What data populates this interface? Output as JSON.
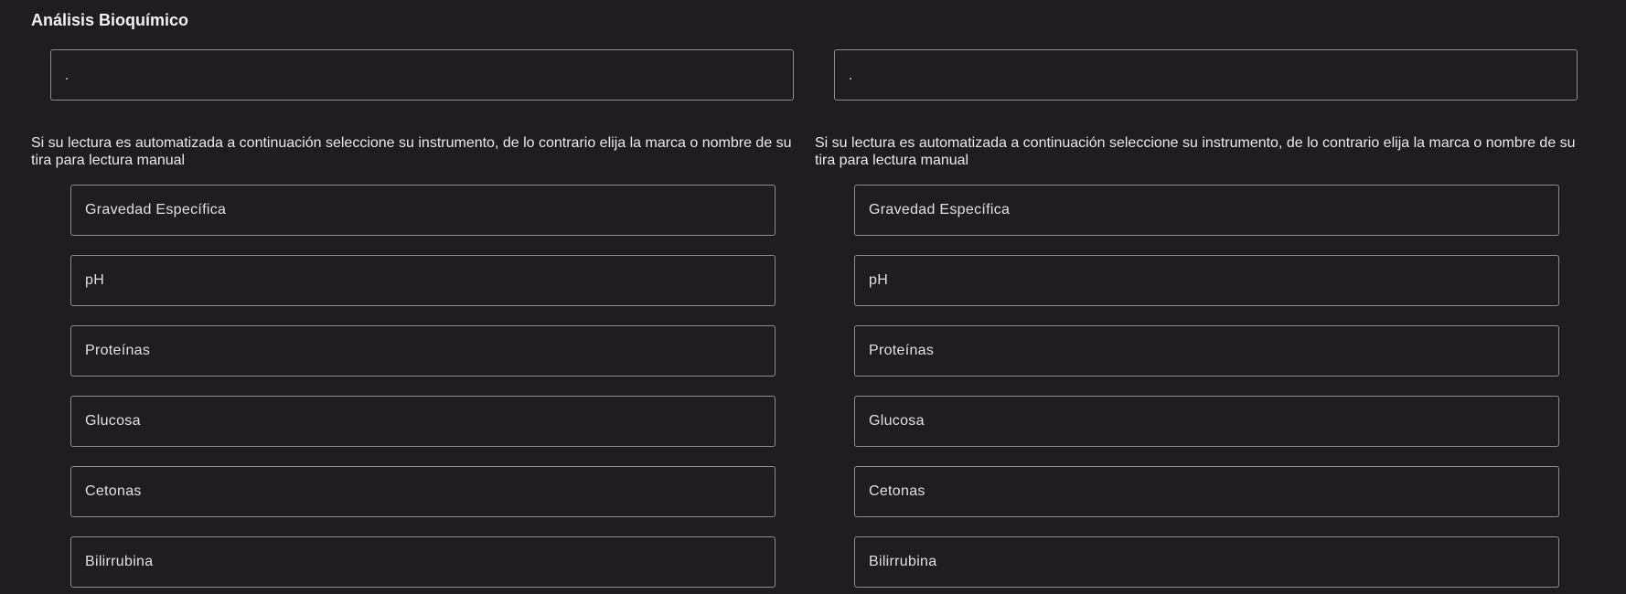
{
  "section": {
    "title": "Análisis Bioquímico"
  },
  "columns": [
    {
      "top_field": {
        "value": "."
      },
      "instruction": "Si su lectura es automatizada a continuación seleccione su instrumento, de lo contrario elija la marca o nombre de su tira para lectura manual",
      "params": [
        "Gravedad Específica",
        "pH",
        "Proteínas",
        "Glucosa",
        "Cetonas",
        "Bilirrubina"
      ]
    },
    {
      "top_field": {
        "value": "."
      },
      "instruction": "Si su lectura es automatizada a continuación seleccione su instrumento, de lo contrario elija la marca o nombre de su tira para lectura manual",
      "params": [
        "Gravedad Específica",
        "pH",
        "Proteínas",
        "Glucosa",
        "Cetonas",
        "Bilirrubina"
      ]
    }
  ]
}
